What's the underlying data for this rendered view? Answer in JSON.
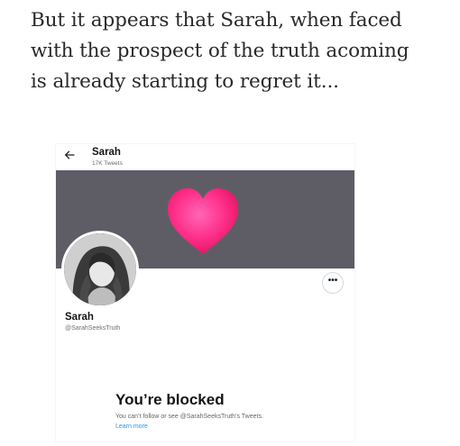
{
  "article": {
    "lines": [
      "But it appears that Sarah, when faced",
      "with the prospect of the truth acoming",
      "is already starting to regret it..."
    ]
  },
  "embed": {
    "header": {
      "back_icon": "back-arrow-icon",
      "name": "Sarah",
      "tweet_count": "17K Tweets"
    },
    "banner": {
      "background_color": "#5e5d66",
      "icon": "heart-icon",
      "heart_color": "#ff2f8a"
    },
    "profile": {
      "avatar_icon": "avatar",
      "more_icon": "more-options-icon",
      "more_label": "•••",
      "name": "Sarah",
      "handle": "@SarahSeeksTruth"
    },
    "blocked": {
      "title": "You’re blocked",
      "description": "You can’t follow or see @SarahSeeksTruth’s Tweets.",
      "learn_more": "Learn more",
      "link_color": "#1d9bf0"
    }
  }
}
